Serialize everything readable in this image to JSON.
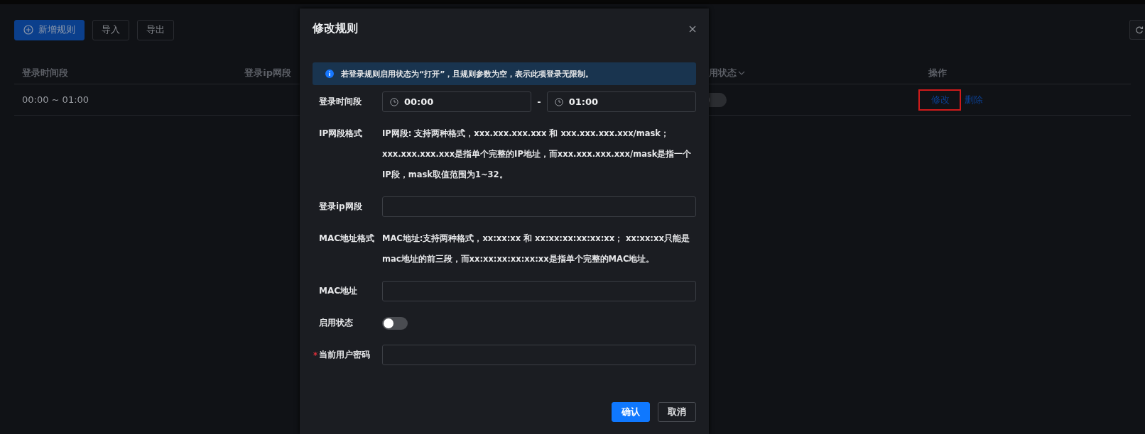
{
  "toolbar": {
    "buttons": [
      {
        "label": "新增规则",
        "kind": "primary"
      },
      {
        "label": "导入",
        "kind": "default"
      },
      {
        "label": "导出",
        "kind": "default"
      }
    ]
  },
  "table": {
    "columns": [
      {
        "label": "登录时间段",
        "kind": "plain"
      },
      {
        "label": "登录ip网段",
        "kind": "plain"
      },
      {
        "label": "用状态",
        "kind": "filter"
      },
      {
        "label": "操作",
        "kind": "plain"
      }
    ],
    "rows": [
      {
        "time": "00:00 ~ 01:00",
        "enabled": false,
        "actions": [
          {
            "label": "修改",
            "highlighted": true
          },
          {
            "label": "删除",
            "highlighted": false
          }
        ]
      }
    ]
  },
  "dialog": {
    "title": "修改规则",
    "notice": "若登录规则启用状态为“打开”，且规则参数为空，表示此项登录无限制。",
    "fields": [
      {
        "kind": "time_range",
        "label": "登录时间段",
        "start": "00:00",
        "separator": "-",
        "end": "01:00"
      },
      {
        "kind": "info",
        "label": "IP网段格式",
        "text": "IP网段: 支持两种格式，xxx.xxx.xxx.xxx 和 xxx.xxx.xxx.xxx/mask； xxx.xxx.xxx.xxx是指单个完整的IP地址，而xxx.xxx.xxx.xxx/mask是指一个IP段，mask取值范围为1~32。"
      },
      {
        "kind": "text",
        "label": "登录ip网段",
        "required": false
      },
      {
        "kind": "info",
        "label": "MAC地址格式",
        "text": "MAC地址:支持两种格式，xx:xx:xx 和 xx:xx:xx:xx:xx:xx； xx:xx:xx只能是mac地址的前三段，而xx:xx:xx:xx:xx:xx是指单个完整的MAC地址。"
      },
      {
        "kind": "text",
        "label": "MAC地址",
        "required": false
      },
      {
        "kind": "switch",
        "label": "启用状态",
        "on": false
      },
      {
        "kind": "text",
        "label": "当前用户密码",
        "required": true
      }
    ],
    "buttons": [
      {
        "label": "确认",
        "kind": "primary"
      },
      {
        "label": "取消",
        "kind": "default"
      }
    ]
  }
}
